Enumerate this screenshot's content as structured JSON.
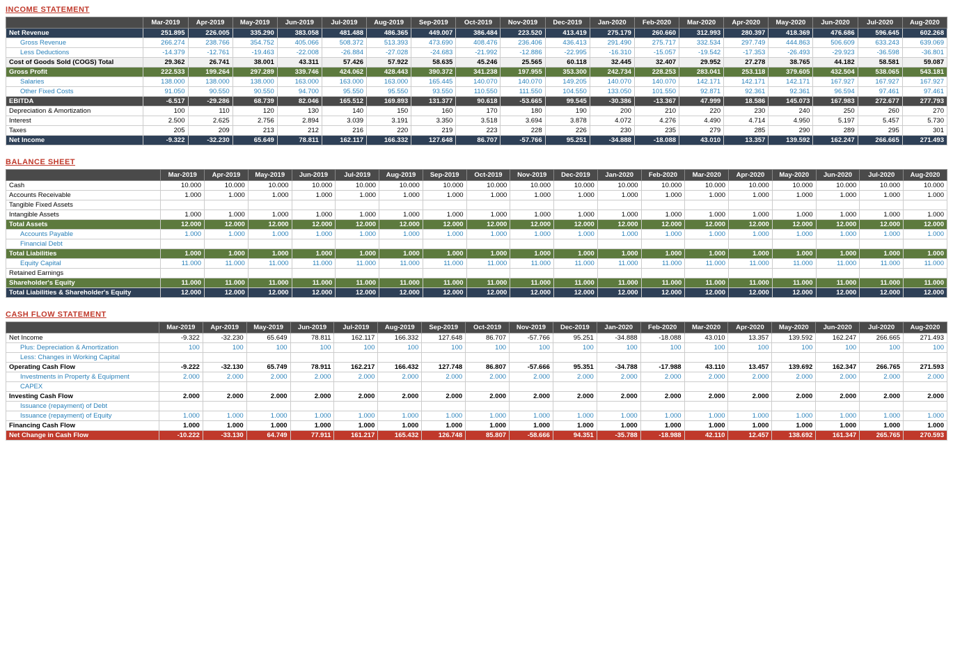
{
  "income_statement": {
    "title": "INCOME STATEMENT",
    "headers": [
      "",
      "Mar-2019",
      "Apr-2019",
      "May-2019",
      "Jun-2019",
      "Jul-2019",
      "Aug-2019",
      "Sep-2019",
      "Oct-2019",
      "Nov-2019",
      "Dec-2019",
      "Jan-2020",
      "Feb-2020",
      "Mar-2020",
      "Apr-2020",
      "May-2020",
      "Jun-2020",
      "Jul-2020",
      "Aug-2020"
    ],
    "rows": [
      {
        "label": "Net Revenue",
        "class": "row-net-revenue",
        "values": [
          "251.895",
          "226.005",
          "335.290",
          "383.058",
          "481.488",
          "486.365",
          "449.007",
          "386.484",
          "223.520",
          "413.419",
          "275.179",
          "260.660",
          "312.993",
          "280.397",
          "418.369",
          "476.686",
          "596.645",
          "602.268"
        ]
      },
      {
        "label": "Gross Revenue",
        "class": "row-gross-revenue indent",
        "values": [
          "266.274",
          "238.766",
          "354.752",
          "405.066",
          "508.372",
          "513.393",
          "473.690",
          "408.476",
          "236.406",
          "436.413",
          "291.490",
          "275.717",
          "332.534",
          "297.749",
          "444.863",
          "506.609",
          "633.243",
          "639.069"
        ]
      },
      {
        "label": "Less Deductions",
        "class": "row-less-deductions indent",
        "values": [
          "-14.379",
          "-12.761",
          "-19.463",
          "-22.008",
          "-26.884",
          "-27.028",
          "-24.683",
          "-21.992",
          "-12.886",
          "-22.995",
          "-16.310",
          "-15.057",
          "-19.542",
          "-17.353",
          "-26.493",
          "-29.923",
          "-36.598",
          "-36.801"
        ]
      },
      {
        "label": "Cost of Goods Sold (COGS) Total",
        "class": "row-cogs",
        "values": [
          "29.362",
          "26.741",
          "38.001",
          "43.311",
          "57.426",
          "57.922",
          "58.635",
          "45.246",
          "25.565",
          "60.118",
          "32.445",
          "32.407",
          "29.952",
          "27.278",
          "38.765",
          "44.182",
          "58.581",
          "59.087"
        ]
      },
      {
        "label": "Gross Profit",
        "class": "row-gross-profit",
        "values": [
          "222.533",
          "199.264",
          "297.289",
          "339.746",
          "424.062",
          "428.443",
          "390.372",
          "341.238",
          "197.955",
          "353.300",
          "242.734",
          "228.253",
          "283.041",
          "253.118",
          "379.605",
          "432.504",
          "538.065",
          "543.181"
        ]
      },
      {
        "label": "Salaries",
        "class": "row-salaries indent",
        "values": [
          "138.000",
          "138.000",
          "138.000",
          "163.000",
          "163.000",
          "163.000",
          "165.445",
          "140.070",
          "140.070",
          "149.205",
          "140.070",
          "140.070",
          "142.171",
          "142.171",
          "142.171",
          "167.927",
          "167.927",
          "167.927"
        ]
      },
      {
        "label": "Other Fixed Costs",
        "class": "row-other-fixed indent",
        "values": [
          "91.050",
          "90.550",
          "90.550",
          "94.700",
          "95.550",
          "95.550",
          "93.550",
          "110.550",
          "111.550",
          "104.550",
          "133.050",
          "101.550",
          "92.871",
          "92.361",
          "92.361",
          "96.594",
          "97.461",
          "97.461"
        ]
      },
      {
        "label": "EBITDA",
        "class": "row-ebitda",
        "values": [
          "-6.517",
          "-29.286",
          "68.739",
          "82.046",
          "165.512",
          "169.893",
          "131.377",
          "90.618",
          "-53.665",
          "99.545",
          "-30.386",
          "-13.367",
          "47.999",
          "18.586",
          "145.073",
          "167.983",
          "272.677",
          "277.793"
        ]
      },
      {
        "label": "Depreciation & Amortization",
        "class": "row-da",
        "values": [
          "100",
          "110",
          "120",
          "130",
          "140",
          "150",
          "160",
          "170",
          "180",
          "190",
          "200",
          "210",
          "220",
          "230",
          "240",
          "250",
          "260",
          "270"
        ]
      },
      {
        "label": "Interest",
        "class": "row-interest",
        "values": [
          "2.500",
          "2.625",
          "2.756",
          "2.894",
          "3.039",
          "3.191",
          "3.350",
          "3.518",
          "3.694",
          "3.878",
          "4.072",
          "4.276",
          "4.490",
          "4.714",
          "4.950",
          "5.197",
          "5.457",
          "5.730"
        ]
      },
      {
        "label": "Taxes",
        "class": "row-taxes",
        "values": [
          "205",
          "209",
          "213",
          "212",
          "216",
          "220",
          "219",
          "223",
          "228",
          "226",
          "230",
          "235",
          "279",
          "285",
          "290",
          "289",
          "295",
          "301"
        ]
      },
      {
        "label": "Net Income",
        "class": "row-net-income",
        "values": [
          "-9.322",
          "-32.230",
          "65.649",
          "78.811",
          "162.117",
          "166.332",
          "127.648",
          "86.707",
          "-57.766",
          "95.251",
          "-34.888",
          "-18.088",
          "43.010",
          "13.357",
          "139.592",
          "162.247",
          "266.665",
          "271.493"
        ]
      }
    ]
  },
  "balance_sheet": {
    "title": "BALANCE SHEET",
    "headers": [
      "",
      "Mar-2019",
      "Apr-2019",
      "May-2019",
      "Jun-2019",
      "Jul-2019",
      "Aug-2019",
      "Sep-2019",
      "Oct-2019",
      "Nov-2019",
      "Dec-2019",
      "Jan-2020",
      "Feb-2020",
      "Mar-2020",
      "Apr-2020",
      "May-2020",
      "Jun-2020",
      "Jul-2020",
      "Aug-2020"
    ],
    "rows": [
      {
        "label": "Cash",
        "class": "row-cash",
        "values": [
          "10.000",
          "10.000",
          "10.000",
          "10.000",
          "10.000",
          "10.000",
          "10.000",
          "10.000",
          "10.000",
          "10.000",
          "10.000",
          "10.000",
          "10.000",
          "10.000",
          "10.000",
          "10.000",
          "10.000",
          "10.000"
        ]
      },
      {
        "label": "Accounts Receivable",
        "class": "row-ar",
        "values": [
          "1.000",
          "1.000",
          "1.000",
          "1.000",
          "1.000",
          "1.000",
          "1.000",
          "1.000",
          "1.000",
          "1.000",
          "1.000",
          "1.000",
          "1.000",
          "1.000",
          "1.000",
          "1.000",
          "1.000",
          "1.000"
        ]
      },
      {
        "label": "Tangible Fixed Assets",
        "class": "row-tfa",
        "values": [
          "",
          "",
          "",
          "",
          "",
          "",
          "",
          "",
          "",
          "",
          "",
          "",
          "",
          "",
          "",
          "",
          "",
          ""
        ]
      },
      {
        "label": "Intangible Assets",
        "class": "row-ia",
        "values": [
          "1.000",
          "1.000",
          "1.000",
          "1.000",
          "1.000",
          "1.000",
          "1.000",
          "1.000",
          "1.000",
          "1.000",
          "1.000",
          "1.000",
          "1.000",
          "1.000",
          "1.000",
          "1.000",
          "1.000",
          "1.000"
        ]
      },
      {
        "label": "Total Assets",
        "class": "row-total-assets",
        "values": [
          "12.000",
          "12.000",
          "12.000",
          "12.000",
          "12.000",
          "12.000",
          "12.000",
          "12.000",
          "12.000",
          "12.000",
          "12.000",
          "12.000",
          "12.000",
          "12.000",
          "12.000",
          "12.000",
          "12.000",
          "12.000"
        ]
      },
      {
        "label": "Accounts Payable",
        "class": "row-accounts-payable indent",
        "values": [
          "1.000",
          "1.000",
          "1.000",
          "1.000",
          "1.000",
          "1.000",
          "1.000",
          "1.000",
          "1.000",
          "1.000",
          "1.000",
          "1.000",
          "1.000",
          "1.000",
          "1.000",
          "1.000",
          "1.000",
          "1.000"
        ]
      },
      {
        "label": "Financial Debt",
        "class": "row-financial-debt indent",
        "values": [
          "",
          "",
          "",
          "",
          "",
          "",
          "",
          "",
          "",
          "",
          "",
          "",
          "",
          "",
          "",
          "",
          "",
          ""
        ]
      },
      {
        "label": "Total Liabilities",
        "class": "row-total-liabilities",
        "values": [
          "1.000",
          "1.000",
          "1.000",
          "1.000",
          "1.000",
          "1.000",
          "1.000",
          "1.000",
          "1.000",
          "1.000",
          "1.000",
          "1.000",
          "1.000",
          "1.000",
          "1.000",
          "1.000",
          "1.000",
          "1.000"
        ]
      },
      {
        "label": "Equity Capital",
        "class": "row-equity-capital indent",
        "values": [
          "11.000",
          "11.000",
          "11.000",
          "11.000",
          "11.000",
          "11.000",
          "11.000",
          "11.000",
          "11.000",
          "11.000",
          "11.000",
          "11.000",
          "11.000",
          "11.000",
          "11.000",
          "11.000",
          "11.000",
          "11.000"
        ]
      },
      {
        "label": "Retained Earnings",
        "class": "",
        "values": [
          "",
          "",
          "",
          "",
          "",
          "",
          "",
          "",
          "",
          "",
          "",
          "",
          "",
          "",
          "",
          "",
          "",
          ""
        ]
      },
      {
        "label": "Shareholder's Equity",
        "class": "row-shareholders-equity",
        "values": [
          "11.000",
          "11.000",
          "11.000",
          "11.000",
          "11.000",
          "11.000",
          "11.000",
          "11.000",
          "11.000",
          "11.000",
          "11.000",
          "11.000",
          "11.000",
          "11.000",
          "11.000",
          "11.000",
          "11.000",
          "11.000"
        ]
      },
      {
        "label": "Total Liabilities & Shareholder's Equity",
        "class": "row-total-liab-equity",
        "values": [
          "12.000",
          "12.000",
          "12.000",
          "12.000",
          "12.000",
          "12.000",
          "12.000",
          "12.000",
          "12.000",
          "12.000",
          "12.000",
          "12.000",
          "12.000",
          "12.000",
          "12.000",
          "12.000",
          "12.000",
          "12.000"
        ]
      }
    ]
  },
  "cash_flow": {
    "title": "CASH FLOW STATEMENT",
    "headers": [
      "",
      "Mar-2019",
      "Apr-2019",
      "May-2019",
      "Jun-2019",
      "Jul-2019",
      "Aug-2019",
      "Sep-2019",
      "Oct-2019",
      "Nov-2019",
      "Dec-2019",
      "Jan-2020",
      "Feb-2020",
      "Mar-2020",
      "Apr-2020",
      "May-2020",
      "Jun-2020",
      "Jul-2020",
      "Aug-2020"
    ],
    "rows": [
      {
        "label": "Net Income",
        "class": "row-cf-net-income",
        "values": [
          "-9.322",
          "-32.230",
          "65.649",
          "78.811",
          "162.117",
          "166.332",
          "127.648",
          "86.707",
          "-57.766",
          "95.251",
          "-34.888",
          "-18.088",
          "43.010",
          "13.357",
          "139.592",
          "162.247",
          "266.665",
          "271.493"
        ]
      },
      {
        "label": "Plus: Depreciation & Amortization",
        "class": "row-cf-da indent",
        "values": [
          "100",
          "100",
          "100",
          "100",
          "100",
          "100",
          "100",
          "100",
          "100",
          "100",
          "100",
          "100",
          "100",
          "100",
          "100",
          "100",
          "100",
          "100"
        ]
      },
      {
        "label": "Less: Changes in Working Capital",
        "class": "row-cf-wc indent",
        "values": [
          "",
          "",
          "",
          "",
          "",
          "",
          "",
          "",
          "",
          "",
          "",
          "",
          "",
          "",
          "",
          "",
          "",
          ""
        ]
      },
      {
        "label": "Operating Cash Flow",
        "class": "row-operating-cf",
        "values": [
          "-9.222",
          "-32.130",
          "65.749",
          "78.911",
          "162.217",
          "166.432",
          "127.748",
          "86.807",
          "-57.666",
          "95.351",
          "-34.788",
          "-17.988",
          "43.110",
          "13.457",
          "139.692",
          "162.347",
          "266.765",
          "271.593"
        ]
      },
      {
        "label": "Investments in Property & Equipment",
        "class": "row-investments indent",
        "values": [
          "2.000",
          "2.000",
          "2.000",
          "2.000",
          "2.000",
          "2.000",
          "2.000",
          "2.000",
          "2.000",
          "2.000",
          "2.000",
          "2.000",
          "2.000",
          "2.000",
          "2.000",
          "2.000",
          "2.000",
          "2.000"
        ]
      },
      {
        "label": "CAPEX",
        "class": "row-capex indent",
        "values": [
          "",
          "",
          "",
          "",
          "",
          "",
          "",
          "",
          "",
          "",
          "",
          "",
          "",
          "",
          "",
          "",
          "",
          ""
        ]
      },
      {
        "label": "Investing Cash Flow",
        "class": "row-investing-cf",
        "values": [
          "2.000",
          "2.000",
          "2.000",
          "2.000",
          "2.000",
          "2.000",
          "2.000",
          "2.000",
          "2.000",
          "2.000",
          "2.000",
          "2.000",
          "2.000",
          "2.000",
          "2.000",
          "2.000",
          "2.000",
          "2.000"
        ]
      },
      {
        "label": "Issuance (repayment) of Debt",
        "class": "row-issuance-debt indent",
        "values": [
          "",
          "",
          "",
          "",
          "",
          "",
          "",
          "",
          "",
          "",
          "",
          "",
          "",
          "",
          "",
          "",
          "",
          ""
        ]
      },
      {
        "label": "Issuance (repayment) of Equity",
        "class": "row-issuance-equity indent",
        "values": [
          "1.000",
          "1.000",
          "1.000",
          "1.000",
          "1.000",
          "1.000",
          "1.000",
          "1.000",
          "1.000",
          "1.000",
          "1.000",
          "1.000",
          "1.000",
          "1.000",
          "1.000",
          "1.000",
          "1.000",
          "1.000"
        ]
      },
      {
        "label": "Financing Cash Flow",
        "class": "row-financing-cf",
        "values": [
          "1.000",
          "1.000",
          "1.000",
          "1.000",
          "1.000",
          "1.000",
          "1.000",
          "1.000",
          "1.000",
          "1.000",
          "1.000",
          "1.000",
          "1.000",
          "1.000",
          "1.000",
          "1.000",
          "1.000",
          "1.000"
        ]
      },
      {
        "label": "Net Change in Cash Flow",
        "class": "row-net-change-cf",
        "values": [
          "-10.222",
          "-33.130",
          "64.749",
          "77.911",
          "161.217",
          "165.432",
          "126.748",
          "85.807",
          "-58.666",
          "94.351",
          "-35.788",
          "-18.988",
          "42.110",
          "12.457",
          "138.692",
          "161.347",
          "265.765",
          "270.593"
        ]
      }
    ]
  }
}
